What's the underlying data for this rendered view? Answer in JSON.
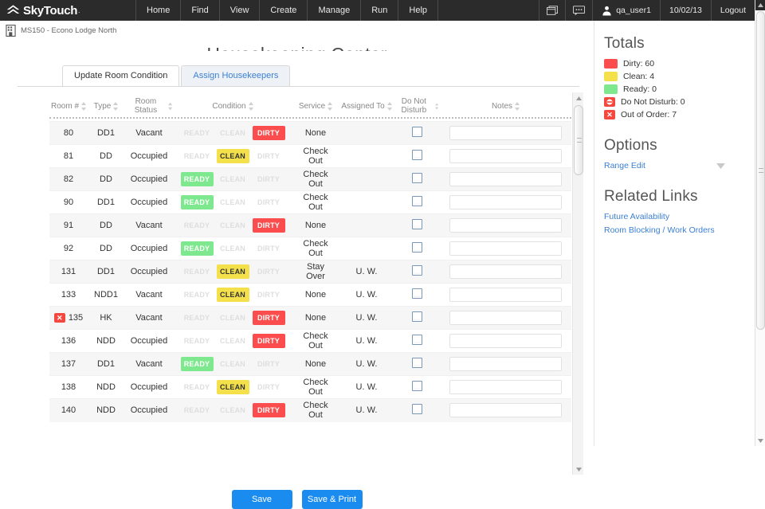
{
  "brand": {
    "name": "SkyTouch",
    "tm": ".",
    "logo_icon": "skytouch-chevron-logo"
  },
  "nav": {
    "items": [
      "Home",
      "Find",
      "View",
      "Create",
      "Manage",
      "Run",
      "Help"
    ]
  },
  "topright": {
    "window_icon": "window-icon",
    "chat_icon": "chat-bubble-icon",
    "user_icon": "user-icon",
    "user": "qa_user1",
    "date": "10/02/13",
    "logout": "Logout"
  },
  "property": {
    "icon": "building-icon",
    "label": "MS150 - Econo Lodge North"
  },
  "page_title": "Housekeeping Center",
  "tabs": [
    {
      "label": "Update Room Condition",
      "active": true
    },
    {
      "label": "Assign Housekeepers",
      "active": false
    }
  ],
  "table": {
    "columns": [
      {
        "label": "Room #",
        "sortable": true
      },
      {
        "label": "Type",
        "sortable": true
      },
      {
        "label": "Room Status",
        "sortable": true
      },
      {
        "label": "Condition",
        "sortable": true
      },
      {
        "label": "Service",
        "sortable": true
      },
      {
        "label": "Assigned To",
        "sortable": true
      },
      {
        "label": "Do Not Disturb",
        "sortable": true
      },
      {
        "label": "Notes",
        "sortable": true
      }
    ],
    "condition_options": [
      "READY",
      "CLEAN",
      "DIRTY"
    ],
    "rows": [
      {
        "room": "80",
        "ooo": false,
        "type": "DD1",
        "status": "Vacant",
        "condition": "DIRTY",
        "service": "None",
        "assigned": "",
        "dnd": false,
        "notes": ""
      },
      {
        "room": "81",
        "ooo": false,
        "type": "DD",
        "status": "Occupied",
        "condition": "CLEAN",
        "service": "Check Out",
        "assigned": "",
        "dnd": false,
        "notes": ""
      },
      {
        "room": "82",
        "ooo": false,
        "type": "DD",
        "status": "Occupied",
        "condition": "READY",
        "service": "Check Out",
        "assigned": "",
        "dnd": false,
        "notes": ""
      },
      {
        "room": "90",
        "ooo": false,
        "type": "DD1",
        "status": "Occupied",
        "condition": "READY",
        "service": "Check Out",
        "assigned": "",
        "dnd": false,
        "notes": ""
      },
      {
        "room": "91",
        "ooo": false,
        "type": "DD",
        "status": "Vacant",
        "condition": "DIRTY",
        "service": "None",
        "assigned": "",
        "dnd": false,
        "notes": ""
      },
      {
        "room": "92",
        "ooo": false,
        "type": "DD",
        "status": "Occupied",
        "condition": "READY",
        "service": "Check Out",
        "assigned": "",
        "dnd": false,
        "notes": ""
      },
      {
        "room": "131",
        "ooo": false,
        "type": "DD1",
        "status": "Occupied",
        "condition": "CLEAN",
        "service": "Stay Over",
        "assigned": "U. W.",
        "dnd": false,
        "notes": ""
      },
      {
        "room": "133",
        "ooo": false,
        "type": "NDD1",
        "status": "Vacant",
        "condition": "CLEAN",
        "service": "None",
        "assigned": "U. W.",
        "dnd": false,
        "notes": ""
      },
      {
        "room": "135",
        "ooo": true,
        "type": "HK",
        "status": "Vacant",
        "condition": "DIRTY",
        "service": "None",
        "assigned": "U. W.",
        "dnd": false,
        "notes": ""
      },
      {
        "room": "136",
        "ooo": false,
        "type": "NDD",
        "status": "Occupied",
        "condition": "DIRTY",
        "service": "Check Out",
        "assigned": "U. W.",
        "dnd": false,
        "notes": ""
      },
      {
        "room": "137",
        "ooo": false,
        "type": "DD1",
        "status": "Vacant",
        "condition": "READY",
        "service": "None",
        "assigned": "U. W.",
        "dnd": false,
        "notes": ""
      },
      {
        "room": "138",
        "ooo": false,
        "type": "NDD",
        "status": "Occupied",
        "condition": "CLEAN",
        "service": "Check Out",
        "assigned": "U. W.",
        "dnd": false,
        "notes": ""
      },
      {
        "room": "140",
        "ooo": false,
        "type": "NDD",
        "status": "Occupied",
        "condition": "DIRTY",
        "service": "Check Out",
        "assigned": "U. W.",
        "dnd": false,
        "notes": ""
      }
    ]
  },
  "buttons": {
    "primary": "Save",
    "secondary": "Save & Print"
  },
  "rail": {
    "totals_heading": "Totals",
    "totals": [
      {
        "label": "Dirty: 60",
        "swatch": "#fb4d4d",
        "icon": "color-swatch"
      },
      {
        "label": "Clean: 4",
        "swatch": "#f3e04b",
        "icon": "color-swatch"
      },
      {
        "label": "Ready: 0",
        "swatch": "#7de88e",
        "icon": "color-swatch"
      },
      {
        "label": "Do Not Disturb: 0",
        "swatch": "#f4483f",
        "icon": "do-not-disturb-icon"
      },
      {
        "label": "Out of Order: 7",
        "swatch": "#f4483f",
        "icon": "out-of-order-icon"
      }
    ],
    "options_heading": "Options",
    "options_link": "Range Edit",
    "options_caret_icon": "chevron-down-icon",
    "related_heading": "Related Links",
    "related_links": [
      "Future Availability",
      "Room Blocking / Work Orders"
    ]
  },
  "colors": {
    "accent_blue": "#1a8cf0",
    "link_blue": "#3b7fd4",
    "dirty": "#fb4d4d",
    "clean": "#f3e04b",
    "ready": "#7de88e",
    "topbar": "#2b2b2b"
  }
}
